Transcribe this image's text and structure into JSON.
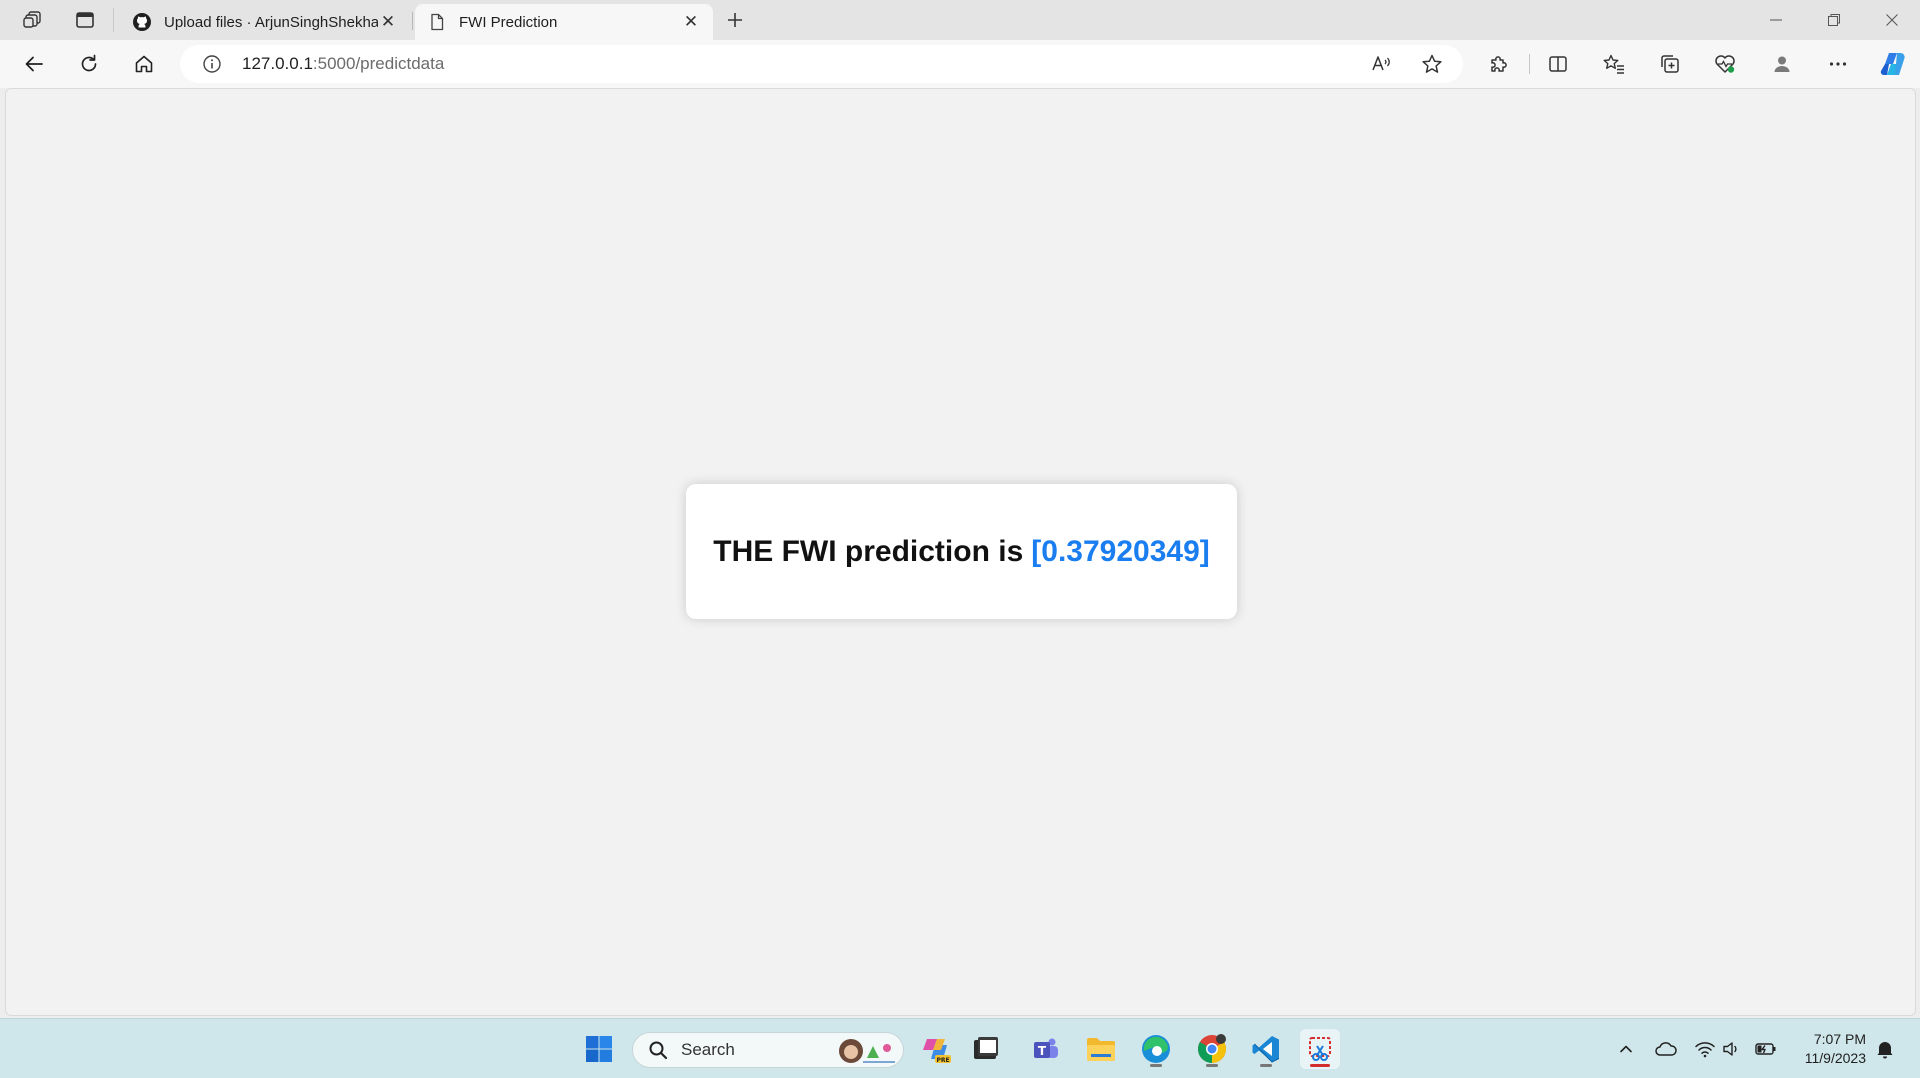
{
  "browser": {
    "tabs": [
      {
        "title": "Upload files · ArjunSinghShekhawat",
        "icon": "github-icon",
        "active": false
      },
      {
        "title": "FWI Prediction",
        "icon": "page-icon",
        "active": true
      }
    ],
    "address": {
      "host": "127.0.0.1",
      "path": ":5000/predictdata"
    }
  },
  "page": {
    "result_label": "THE FWI prediction is",
    "result_value": "[0.37920349]",
    "accent_color": "#1a7ef0"
  },
  "taskbar": {
    "search_label": "Search",
    "clock_time": "7:07 PM",
    "clock_date": "11/9/2023"
  }
}
